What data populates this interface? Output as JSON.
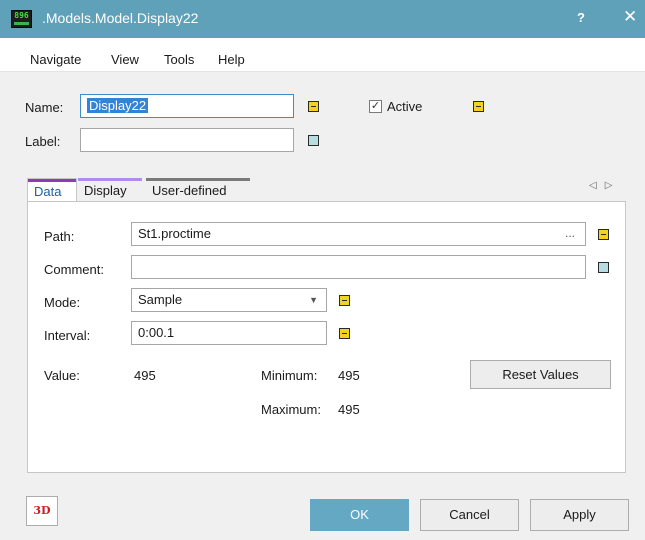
{
  "window": {
    "title": ".Models.Model.Display22",
    "help_label": "?",
    "close_label": "✕",
    "icon_text": "896"
  },
  "menu": {
    "items": [
      "Navigate",
      "View",
      "Tools",
      "Help"
    ]
  },
  "header": {
    "name_label": "Name:",
    "name_value": "Display22",
    "label_label": "Label:",
    "label_value": "",
    "active_label": "Active",
    "active_checked": true
  },
  "tabs": [
    {
      "label": "Data",
      "color": "#8b3ab8"
    },
    {
      "label": "Display",
      "color": "#b28af0"
    },
    {
      "label": "User-defined",
      "color": "#7a7a7a"
    }
  ],
  "tab_scroll": {
    "left": "◁",
    "right": "▷"
  },
  "data_tab": {
    "path_label": "Path:",
    "path_value": "St1.proctime",
    "path_browse": "...",
    "comment_label": "Comment:",
    "comment_value": "",
    "mode_label": "Mode:",
    "mode_value": "Sample",
    "interval_label": "Interval:",
    "interval_value": "0:00.1",
    "value_label": "Value:",
    "value": "495",
    "minimum_label": "Minimum:",
    "minimum": "495",
    "maximum_label": "Maximum:",
    "maximum": "495",
    "reset_label": "Reset Values"
  },
  "footer": {
    "btn3d_label": "3D",
    "ok_label": "OK",
    "cancel_label": "Cancel",
    "apply_label": "Apply"
  },
  "colors": {
    "titlebar": "#5fa1b9",
    "primary_button": "#64a8c4",
    "indicator_yellow": "#f5d21f",
    "indicator_blue": "#b5dde2",
    "selection": "#3384d5"
  }
}
